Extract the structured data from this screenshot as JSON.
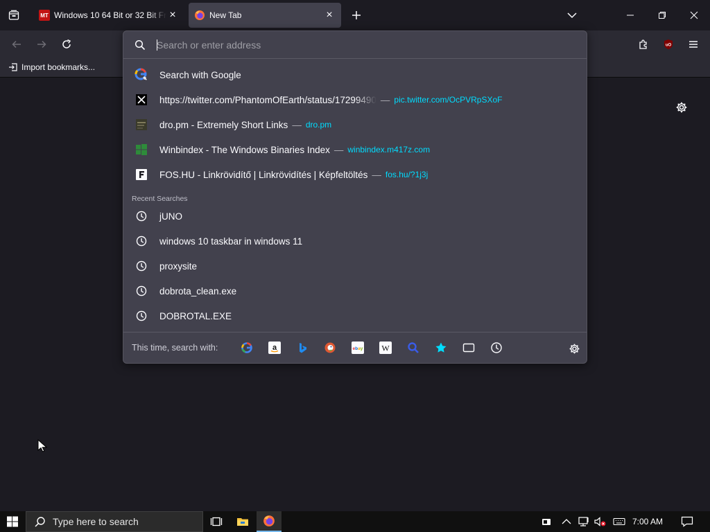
{
  "tabs": [
    {
      "favicon": "mt-favicon",
      "favicon_text": "MT",
      "title": "Windows 10 64 Bit or 32 Bit Free",
      "close": "×"
    },
    {
      "favicon": "firefox-favicon",
      "title": "New Tab",
      "close": "×"
    }
  ],
  "bookmarks_toolbar": {
    "import_label": "Import bookmarks..."
  },
  "urlbar": {
    "placeholder": "Search or enter address",
    "search_suggestion": "Search with Google",
    "results": [
      {
        "title": "https://twitter.com/PhantomOfEarth/status/17299490",
        "sep": "—",
        "url": "pic.twitter.com/OcPVRpSXoF",
        "icon": "x-icon"
      },
      {
        "title": "dro.pm - Extremely Short Links",
        "sep": "—",
        "url": "dro.pm",
        "icon": "dropm-icon"
      },
      {
        "title": "Winbindex - The Windows Binaries Index",
        "sep": "—",
        "url": "winbindex.m417z.com",
        "icon": "windows-icon"
      },
      {
        "title": "FOS.HU - Linkrövidítő | Linkrövidítés | Képfeltöltés",
        "sep": "—",
        "url": "fos.hu/?1j3j",
        "icon": "fos-icon"
      }
    ],
    "recent_label": "Recent Searches",
    "recent_searches": [
      "jUNO",
      "windows 10 taskbar in windows 11",
      "proxysite",
      "dobrota_clean.exe",
      "DOBROTAL.EXE"
    ],
    "oneoff_label": "This time, search with:",
    "engines": [
      "google-icon",
      "amazon-icon",
      "bing-icon",
      "duckduckgo-icon",
      "ebay-icon",
      "wikipedia-icon",
      "search-engine-icon",
      "bookmarks-icon",
      "tabs-icon",
      "history-icon"
    ]
  },
  "taskbar": {
    "search_placeholder": "Type here to search",
    "time": "7:00 AM"
  },
  "colors": {
    "accent": "#00ddff",
    "popup_bg": "#42414d",
    "page_bg": "#1c1b22",
    "toolbar_bg": "#2b2a33",
    "taskbar_highlight": "#76b9ed"
  }
}
